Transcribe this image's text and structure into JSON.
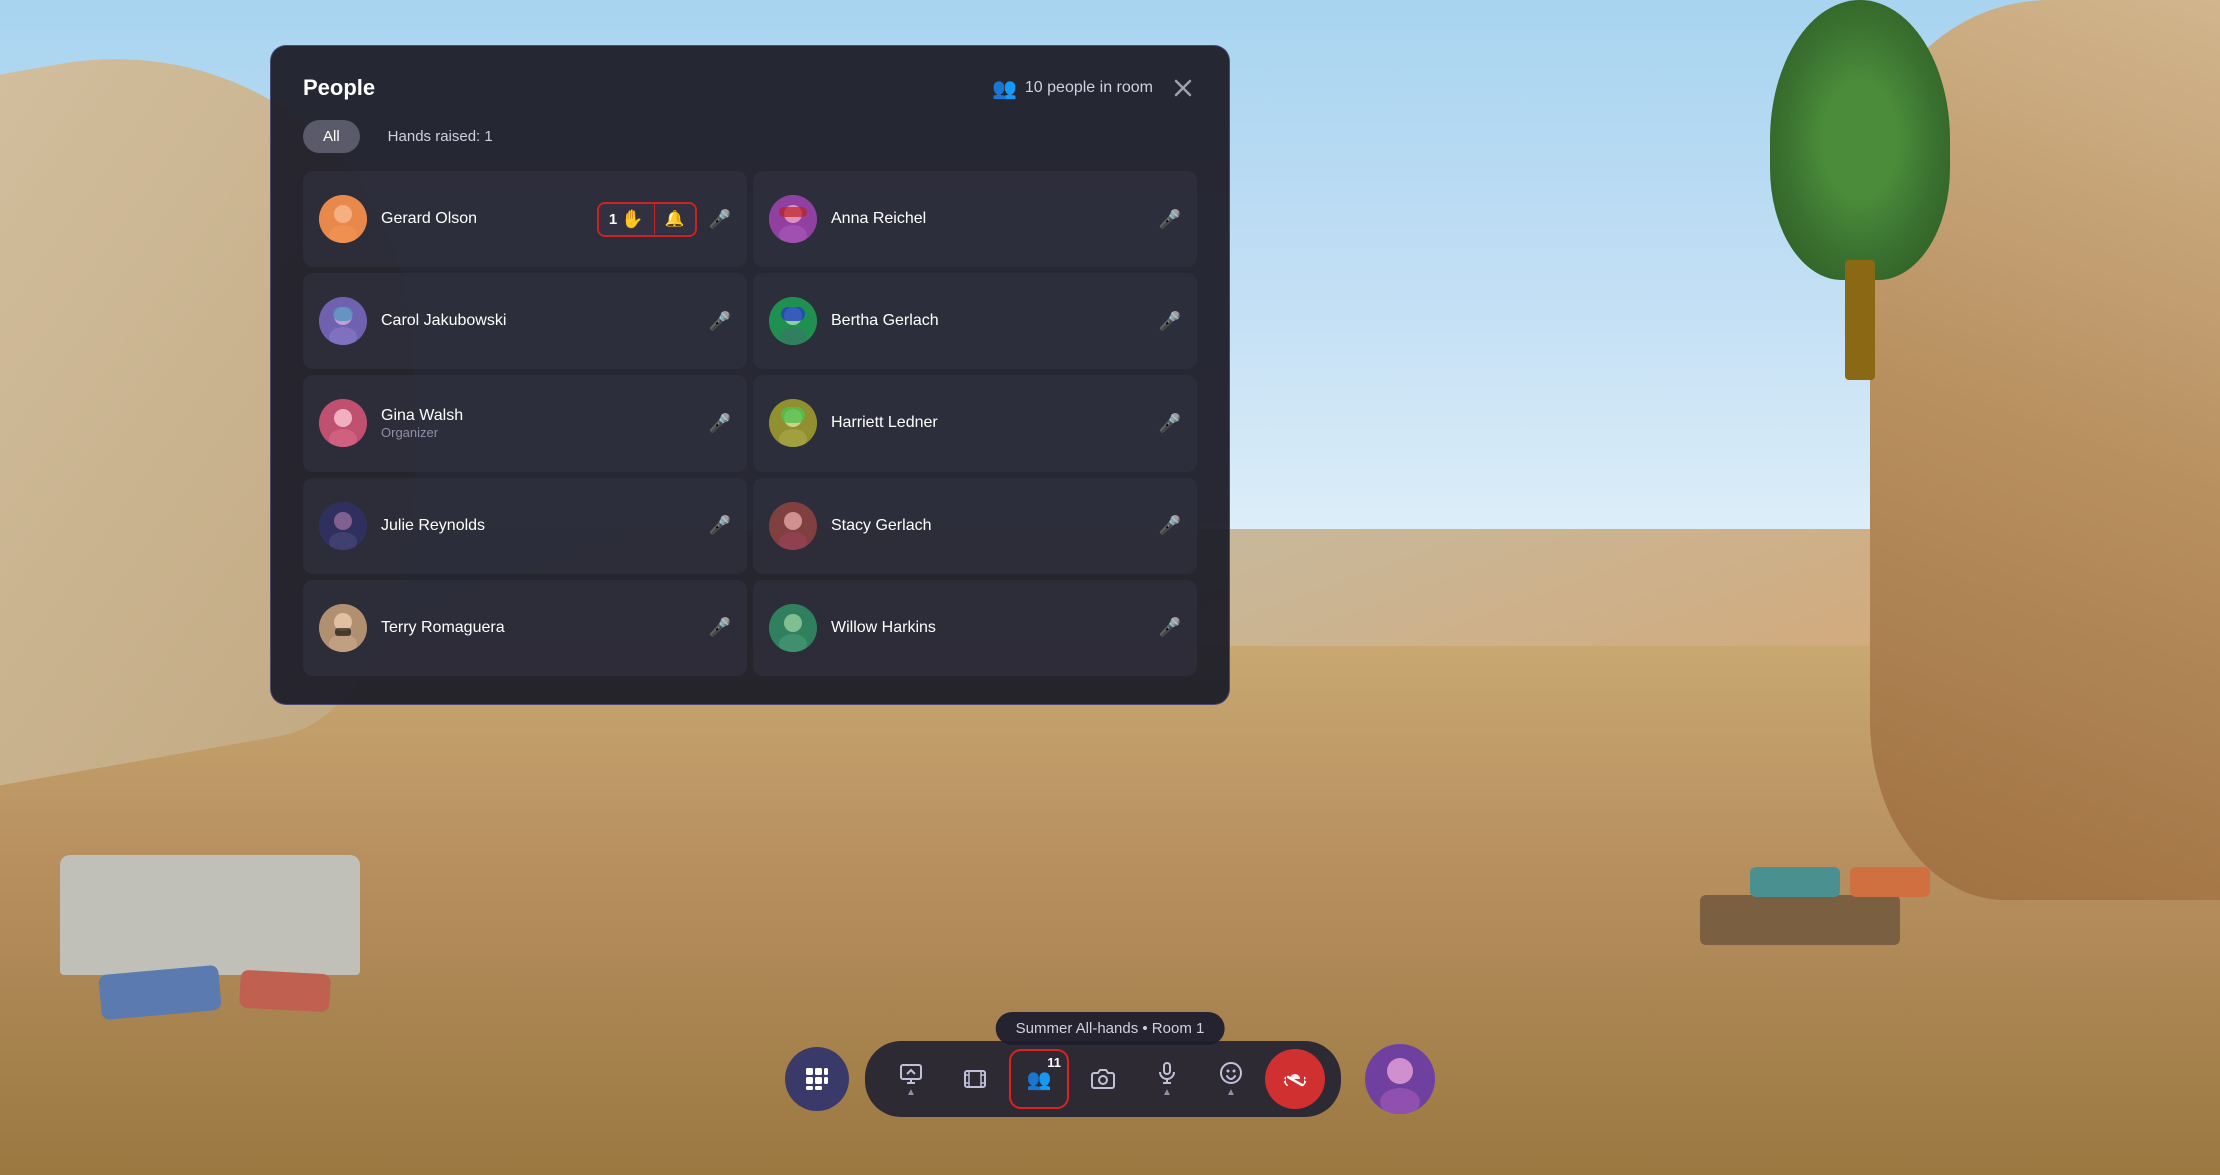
{
  "panel": {
    "title": "People",
    "people_count": "10 people in room",
    "close_label": "×",
    "filters": {
      "all_label": "All",
      "hands_raised_label": "Hands raised: 1"
    },
    "participants": [
      {
        "id": "gerard",
        "name": "Gerard Olson",
        "role": "",
        "avatar_class": "avatar-gerard",
        "avatar_emoji": "🧑",
        "has_hand_raised": true,
        "hand_count": "1",
        "mic_active": true,
        "has_bell": true,
        "side": "left"
      },
      {
        "id": "anna",
        "name": "Anna Reichel",
        "role": "",
        "avatar_class": "avatar-anna",
        "avatar_emoji": "👩",
        "has_hand_raised": false,
        "mic_active": false,
        "has_bell": false,
        "side": "right"
      },
      {
        "id": "carol",
        "name": "Carol Jakubowski",
        "role": "",
        "avatar_class": "avatar-carol",
        "avatar_emoji": "👩",
        "has_hand_raised": false,
        "mic_active": false,
        "has_bell": false,
        "side": "left"
      },
      {
        "id": "bertha",
        "name": "Bertha Gerlach",
        "role": "",
        "avatar_class": "avatar-bertha",
        "avatar_emoji": "👩",
        "has_hand_raised": false,
        "mic_active": false,
        "has_bell": false,
        "side": "right"
      },
      {
        "id": "gina",
        "name": "Gina Walsh",
        "role": "Organizer",
        "avatar_class": "avatar-gina",
        "avatar_emoji": "👩",
        "has_hand_raised": false,
        "mic_active": true,
        "has_bell": false,
        "side": "left"
      },
      {
        "id": "harriett",
        "name": "Harriett Ledner",
        "role": "",
        "avatar_class": "avatar-harriett",
        "avatar_emoji": "👩",
        "has_hand_raised": false,
        "mic_active": false,
        "has_bell": false,
        "side": "right"
      },
      {
        "id": "julie",
        "name": "Julie Reynolds",
        "role": "",
        "avatar_class": "avatar-julie",
        "avatar_emoji": "👩",
        "has_hand_raised": false,
        "mic_active": false,
        "has_bell": false,
        "side": "left"
      },
      {
        "id": "stacy",
        "name": "Stacy Gerlach",
        "role": "",
        "avatar_class": "avatar-stacy",
        "avatar_emoji": "👩",
        "has_hand_raised": false,
        "mic_active": false,
        "has_bell": false,
        "side": "right"
      },
      {
        "id": "terry",
        "name": "Terry Romaguera",
        "role": "",
        "avatar_class": "avatar-terry",
        "avatar_emoji": "🧔",
        "has_hand_raised": false,
        "mic_active": false,
        "has_bell": false,
        "side": "left"
      },
      {
        "id": "willow",
        "name": "Willow Harkins",
        "role": "",
        "avatar_class": "avatar-willow",
        "avatar_emoji": "👩",
        "has_hand_raised": false,
        "mic_active": false,
        "has_bell": false,
        "side": "right"
      }
    ]
  },
  "toolbar": {
    "apps_btn_label": "⊞",
    "present_label": "Present",
    "present_icon": "▲",
    "film_label": "",
    "people_count": "11",
    "people_icon": "👥",
    "camera_icon": "📷",
    "mic_icon": "🎤",
    "emoji_icon": "😊",
    "end_icon": "📞",
    "tooltip": "Summer All-hands • Room 1"
  }
}
